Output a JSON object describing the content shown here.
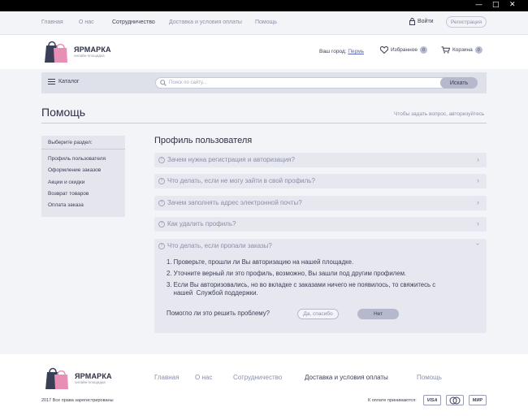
{
  "window": {
    "controls": [
      "—",
      "□",
      "✕"
    ]
  },
  "topnav": {
    "links": [
      "Главная",
      "О нас",
      "Сотрудничество",
      "Доставка и условия оплаты",
      "Помощь"
    ],
    "login": "Войти",
    "register": "Регистрация"
  },
  "header": {
    "logo_name": "ЯРМАРКА",
    "logo_tagline": "онлайн-площадка",
    "city_label": "Ваш город:",
    "city_value": "Пермь",
    "favorites": "Избранное",
    "favorites_count": "0",
    "cart": "Корзина",
    "cart_count": "0"
  },
  "search": {
    "catalog": "Каталог",
    "placeholder": "Поиск по сайту...",
    "button": "Искать"
  },
  "page": {
    "title": "Помощь",
    "auth_hint": "Чтобы задать вопрос, авторизуйтесь"
  },
  "sidebar": {
    "heading": "Выберите раздел:",
    "items": [
      "Профиль пользователя",
      "Оформление заказов",
      "Акции и скидки",
      "Возврат товаров",
      "Оплата заказа"
    ]
  },
  "faq": {
    "section_title": "Профиль пользователя",
    "questions": [
      "Зачем нужна регистрация и авторизация?",
      "Что делать, если не могу зайти в свой профиль?",
      "Зачем заполнять адрес электронной почты?",
      "Как удалить профиль?"
    ],
    "open_question": "Что делать, если пропали заказы?",
    "answer_lines": [
      "1. Проверьте, прошли ли Вы авторизацию на нашей площадке.",
      "2. Уточните верный ли это профиль, возможно, Вы зашли под другим профилем.",
      "3. Если Вы авторизовались, но во вкладке с заказами ничего не появилось, то свяжитесь с",
      "    нашей  Службой поддержки."
    ],
    "helpful_question": "Помогло ли это решить проблему?",
    "yes_button": "Да, спасибо",
    "no_button": "Нет"
  },
  "footer": {
    "logo_name": "ЯРМАРКА",
    "logo_tagline": "онлайн-площадка",
    "links": [
      "Главная",
      "О нас",
      "Сотрудничество",
      "Доставка и условия оплаты",
      "Помощь"
    ],
    "copyright": "2017 Все права зарегистрированы",
    "pay_hint": "К оплате принимаются:",
    "pay_methods": [
      "VISA",
      "MC",
      "МИР"
    ]
  },
  "colors": {
    "accent": "#5a67b8",
    "bag_pink": "#e88fb6",
    "bag_dark": "#3b3f55"
  }
}
